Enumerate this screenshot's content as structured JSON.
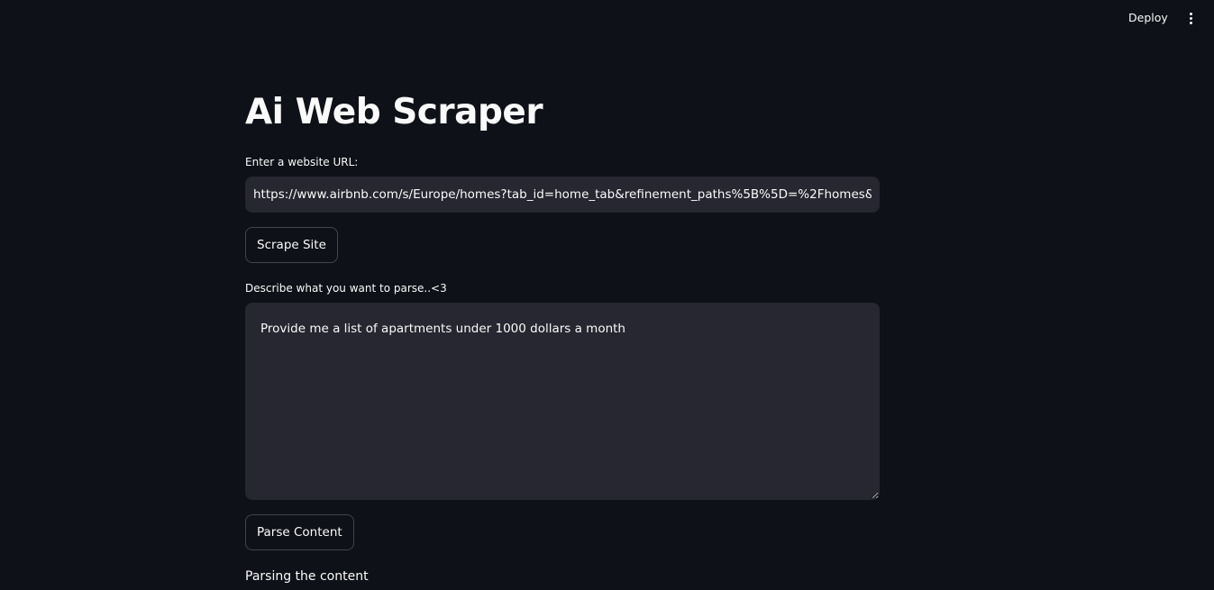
{
  "header": {
    "deploy_label": "Deploy",
    "menu_icon": "vertical-ellipsis-icon"
  },
  "page": {
    "title": "Ai Web Scraper",
    "url_field": {
      "label": "Enter a website URL:",
      "value": "https://www.airbnb.com/s/Europe/homes?tab_id=home_tab&refinement_paths%5B%5D=%2Fhomes&"
    },
    "scrape_button_label": "Scrape Site",
    "parse_field": {
      "label": "Describe what you want to parse..<3",
      "value": "Provide me a list of apartments under 1000 dollars a month"
    },
    "parse_button_label": "Parse Content",
    "status_text": "Parsing the content"
  },
  "colors": {
    "background": "#0e1117",
    "input_background": "#262730",
    "text": "#fafafa"
  }
}
